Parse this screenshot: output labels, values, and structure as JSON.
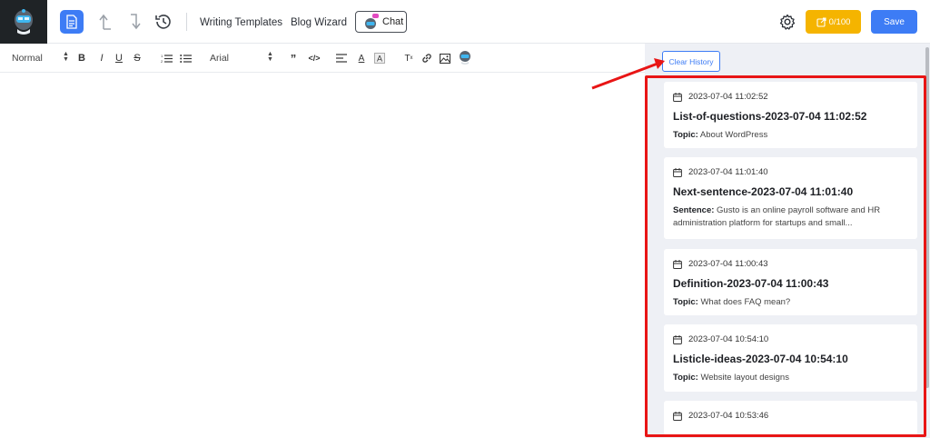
{
  "header": {
    "nav": [
      "Writing Templates",
      "Blog Wizard"
    ],
    "chat_label": "Chat",
    "credits": "0/100",
    "save_label": "Save"
  },
  "toolbar": {
    "heading_select": "Normal",
    "font_select": "Arial"
  },
  "sidebar": {
    "clear_label": "Clear History",
    "history": [
      {
        "date": "2023-07-04 11:02:52",
        "title": "List-of-questions-2023-07-04 11:02:52",
        "field": "Topic:",
        "value": "About WordPress"
      },
      {
        "date": "2023-07-04 11:01:40",
        "title": "Next-sentence-2023-07-04 11:01:40",
        "field": "Sentence:",
        "value": "Gusto is an online payroll software and HR administration platform for startups and small..."
      },
      {
        "date": "2023-07-04 11:00:43",
        "title": "Definition-2023-07-04 11:00:43",
        "field": "Topic:",
        "value": "What does FAQ mean?"
      },
      {
        "date": "2023-07-04 10:54:10",
        "title": "Listicle-ideas-2023-07-04 10:54:10",
        "field": "Topic:",
        "value": "Website layout designs"
      },
      {
        "date": "2023-07-04 10:53:46",
        "title": "",
        "field": "",
        "value": ""
      }
    ]
  },
  "colors": {
    "primary": "#3d7cf5",
    "credits": "#f5b400",
    "highlight": "#e81515",
    "logo_bg": "#1f2326",
    "sidebar_bg": "#eef0f5"
  }
}
